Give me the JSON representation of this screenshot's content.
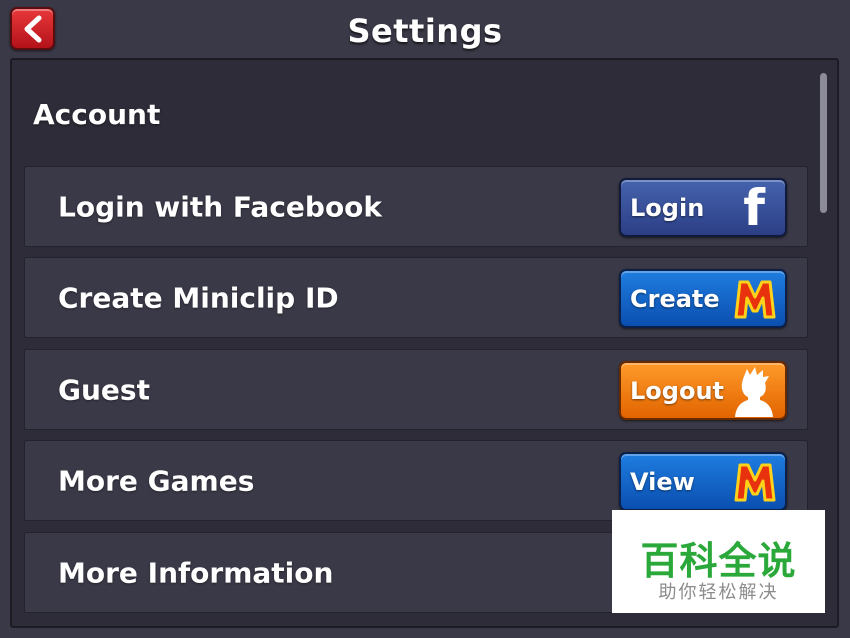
{
  "header": {
    "title": "Settings",
    "back_icon": "chevron-left-icon"
  },
  "account": {
    "section_title": "Account",
    "rows": [
      {
        "label": "Login with Facebook",
        "button": "Login",
        "button_color": "#3a55a0",
        "icon": "facebook-icon",
        "icon_text": "f"
      },
      {
        "label": "Create Miniclip ID",
        "button": "Create",
        "button_color": "#1668cc",
        "icon": "miniclip-m-icon"
      },
      {
        "label": "Guest",
        "button": "Logout",
        "button_color": "#f07d12",
        "icon": "person-silhouette-icon"
      },
      {
        "label": "More Games",
        "button": "View",
        "button_color": "#1668cc",
        "icon": "miniclip-m-icon"
      },
      {
        "label": "More Information"
      }
    ]
  },
  "watermark": {
    "main": "百科全说",
    "sub": "助你轻松解决"
  }
}
